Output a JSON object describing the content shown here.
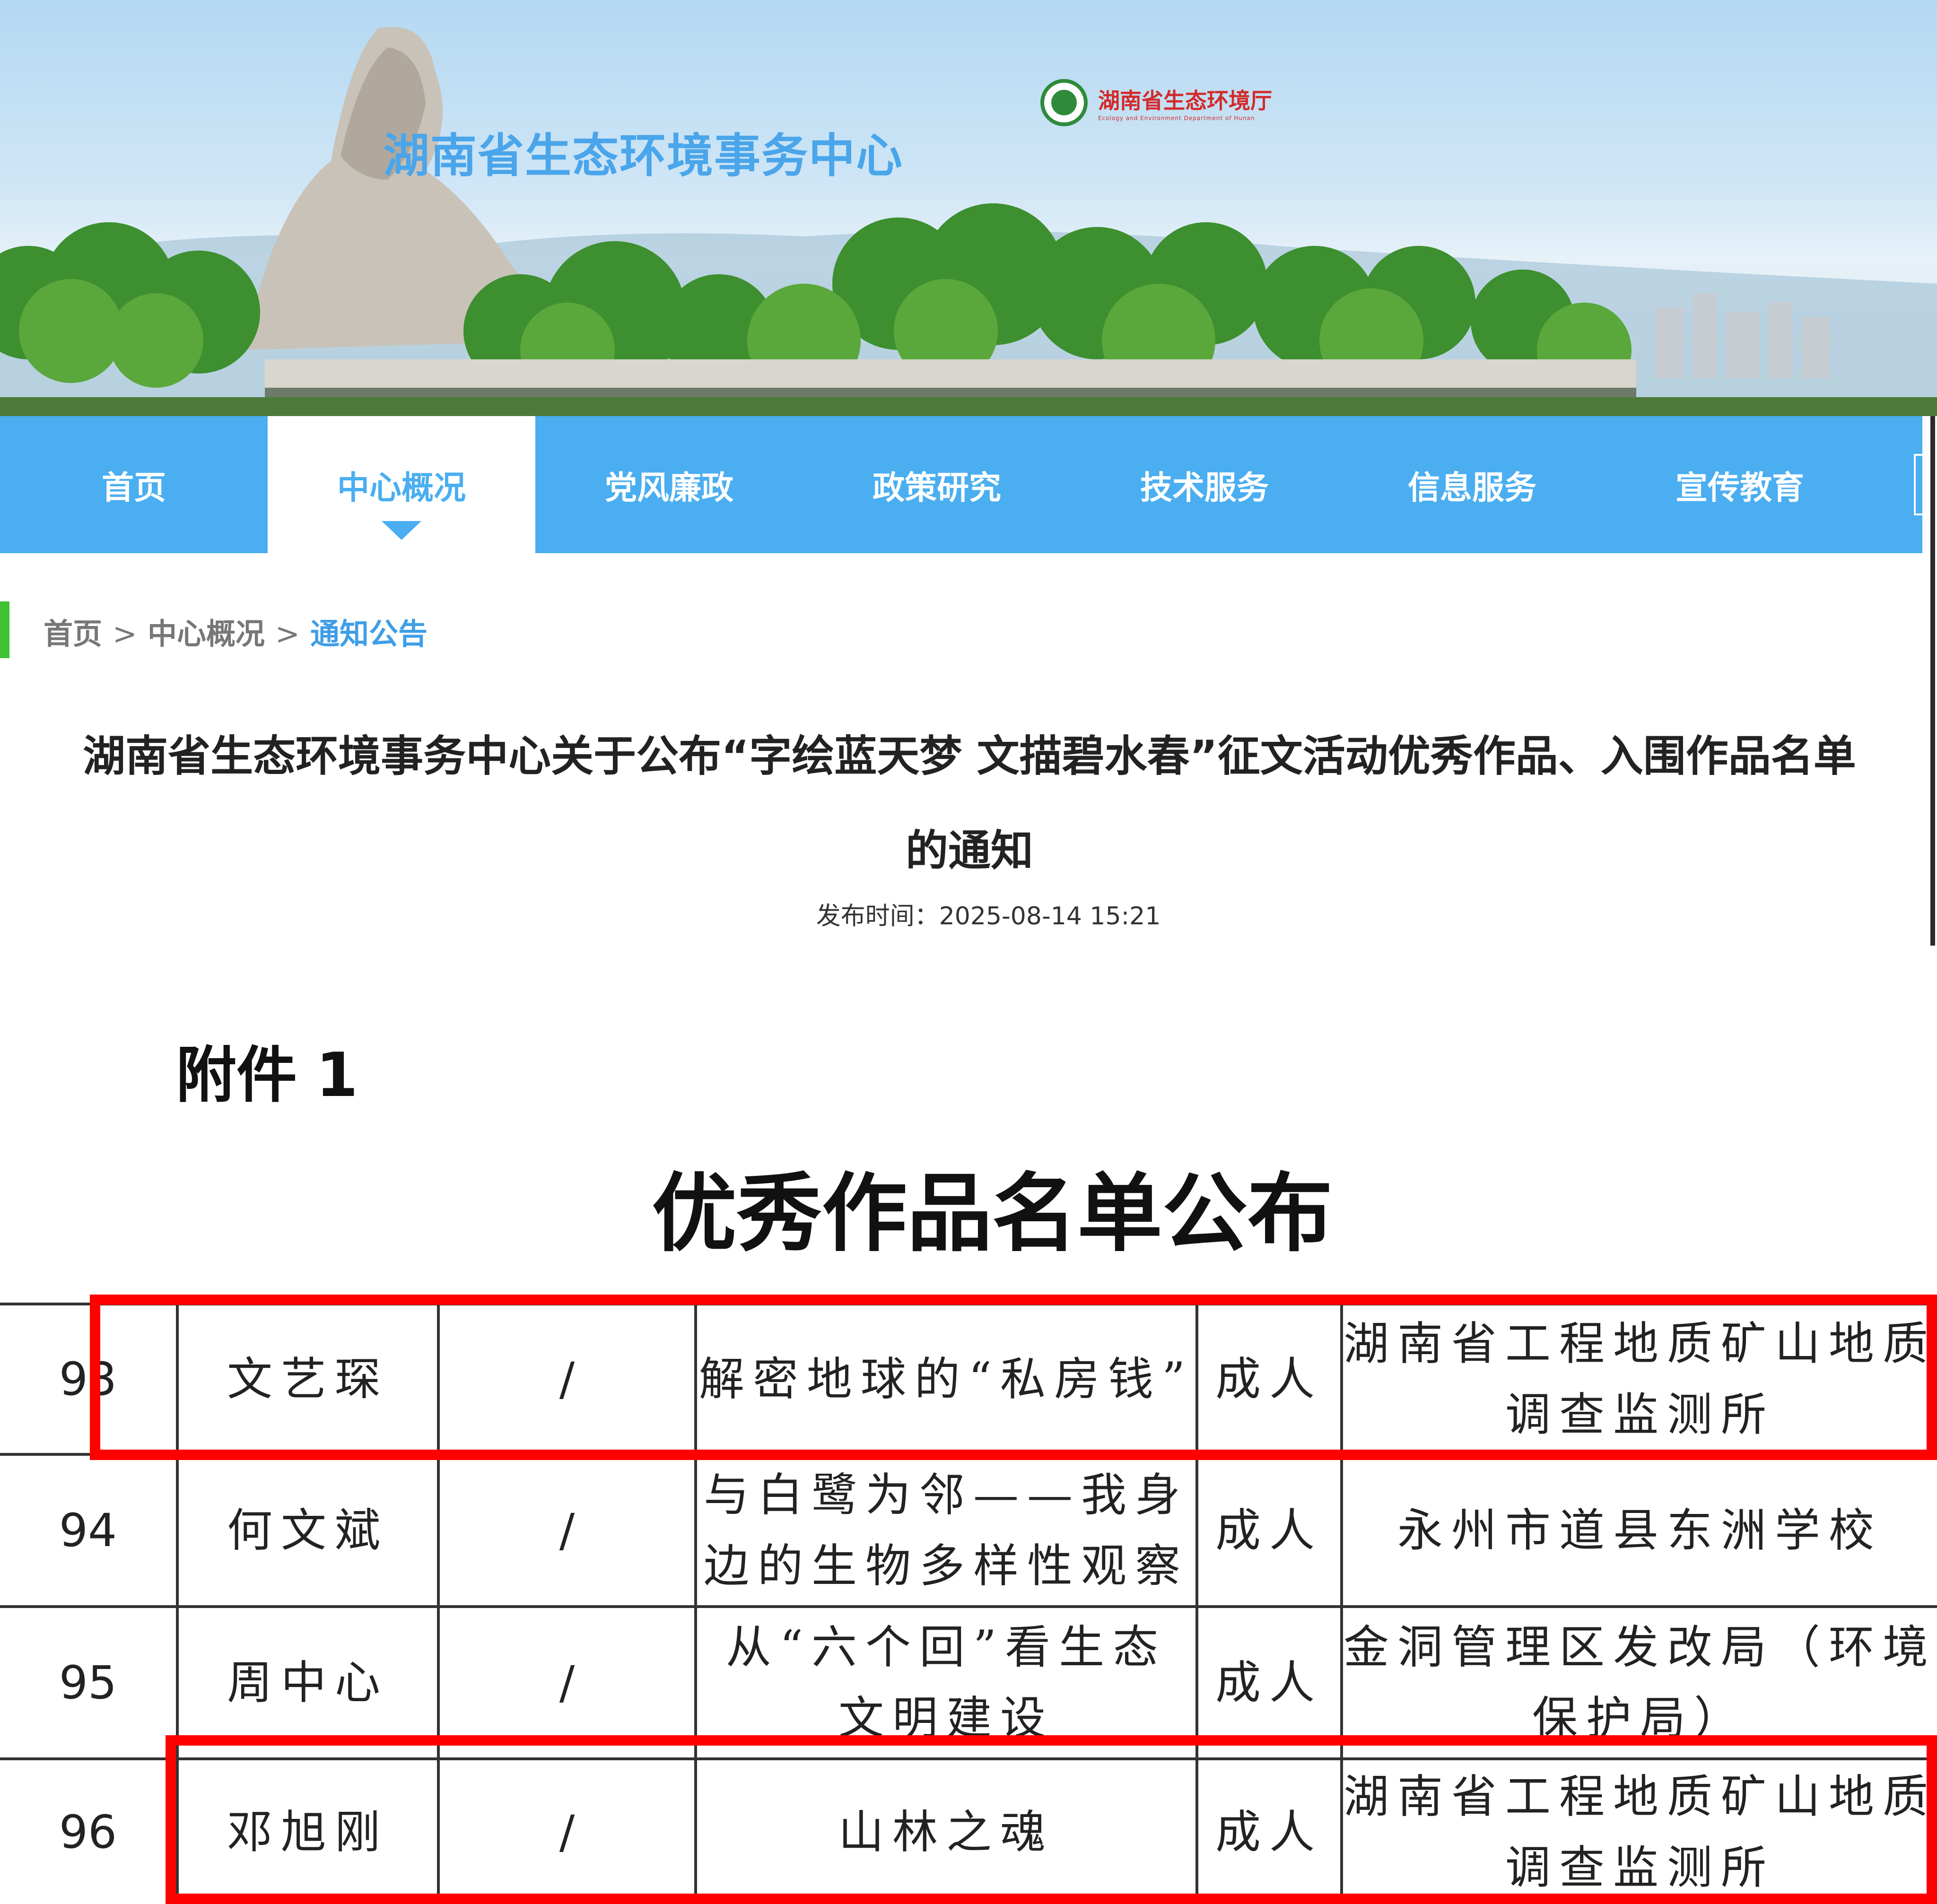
{
  "header": {
    "site_title": "湖南省生态环境事务中心",
    "dept_logo_cn": "湖南省生态环境厅",
    "dept_logo_en": "Ecology and Environment Department of Hunan",
    "logo_icon": "environment-emblem-icon"
  },
  "nav": {
    "items": [
      "首页",
      "中心概况",
      "党风廉政",
      "政策研究",
      "技术服务",
      "信息服务",
      "宣传教育"
    ],
    "active_index": 1
  },
  "breadcrumb": {
    "items": [
      "首页",
      "中心概况",
      "通知公告"
    ],
    "separator": ">"
  },
  "article": {
    "title_line1": "湖南省生态环境事务中心关于公布“字绘蓝天梦 文描碧水春”征文活动优秀作品、入围作品名单",
    "title_line2": "的通知",
    "publish_label": "发布时间：",
    "publish_time": "2025-08-14 15:21"
  },
  "document": {
    "attachment_label": "附件",
    "attachment_number": "1",
    "heading": "优秀作品名单公布",
    "rows": [
      {
        "no": "93",
        "author": "文艺琛",
        "tutor": "/",
        "title_lines": [
          "解密地球的“私房钱”"
        ],
        "group": "成人",
        "unit_lines": [
          "湖南省工程地质矿山地质",
          "调查监测所"
        ]
      },
      {
        "no": "94",
        "author": "何文斌",
        "tutor": "/",
        "title_lines": [
          "与白鹭为邻——我身",
          "边的生物多样性观察"
        ],
        "group": "成人",
        "unit_lines": [
          "永州市道县东洲学校"
        ]
      },
      {
        "no": "95",
        "author": "周中心",
        "tutor": "/",
        "title_lines": [
          "从“六个回”看生态",
          "文明建设"
        ],
        "group": "成人",
        "unit_lines": [
          "金洞管理区发改局（环境",
          "保护局）"
        ]
      },
      {
        "no": "96",
        "author": "邓旭刚",
        "tutor": "/",
        "title_lines": [
          "山林之魂"
        ],
        "group": "成人",
        "unit_lines": [
          "湖南省工程地质矿山地质",
          "调查监测所"
        ]
      }
    ],
    "highlight_color": "#ff0000"
  },
  "colors": {
    "nav_bg": "#4aaef1",
    "breadcrumb_current": "#3f9ee6",
    "breadcrumb_bar": "#3ec232",
    "site_title": "#4aa5ea"
  }
}
